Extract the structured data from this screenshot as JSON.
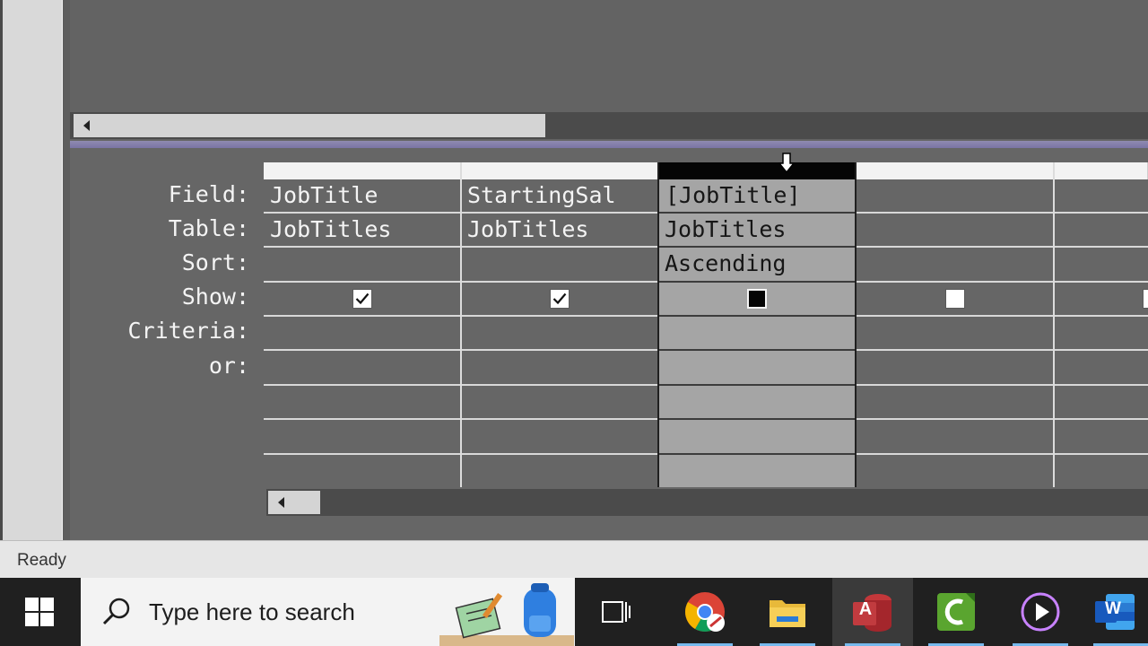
{
  "status_bar": {
    "text": "Ready"
  },
  "grid": {
    "row_labels": [
      "Field:",
      "Table:",
      "Sort:",
      "Show:",
      "Criteria:",
      "or:"
    ],
    "columns": [
      {
        "field": "JobTitle",
        "table": "JobTitles",
        "sort": "",
        "show": true,
        "selected": false
      },
      {
        "field": "StartingSal",
        "table": "JobTitles",
        "sort": "",
        "show": true,
        "selected": false
      },
      {
        "field": "[JobTitle]",
        "table": "JobTitles",
        "sort": "Ascending",
        "show": true,
        "selected": true
      },
      {
        "field": "",
        "table": "",
        "sort": "",
        "show": false,
        "selected": false
      },
      {
        "field": "",
        "table": "",
        "sort": "",
        "show": false,
        "selected": false
      }
    ]
  },
  "taskbar": {
    "search_placeholder": "Type here to search",
    "apps": [
      "start-icon",
      "search-icon",
      "search-highlight-icon",
      "task-view-icon",
      "chrome-icon",
      "file-explorer-icon",
      "access-icon",
      "camtasia-icon",
      "media-player-icon",
      "word-icon"
    ],
    "active_app": "access-icon",
    "access_letter": "A",
    "word_letter": "W",
    "camtasia_letter": "C"
  },
  "colors": {
    "background": "#666666",
    "selected_column": "#a5a5a5",
    "splitter": "#8f8ab1",
    "taskbar": "#202020",
    "taskbar_accent": "#76b9ed"
  }
}
